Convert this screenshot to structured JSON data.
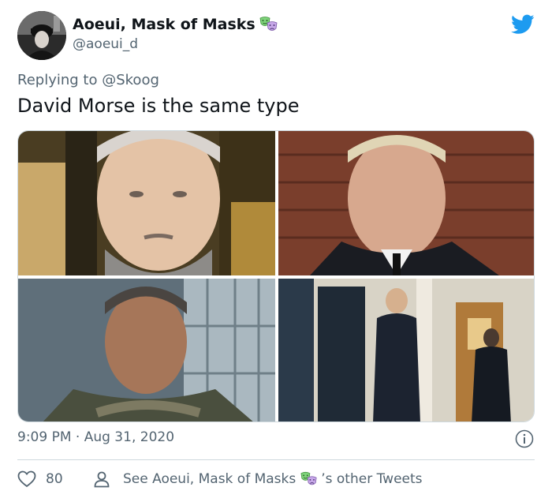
{
  "tweet": {
    "display_name": "Aoeui, Mask of Masks",
    "name_emoji": "performing-arts-masks",
    "handle": "@aoeui_d",
    "replying_prefix": "Replying to",
    "replying_handle": "@Skoog",
    "text": "David Morse is the same type",
    "timestamp": "9:09 PM · Aug 31, 2020",
    "likes": "80",
    "see_other_prefix": "See Aoeui, Mask of Masks",
    "see_other_suffix": "’s other Tweets"
  },
  "icons": {
    "brand": "twitter-bird-icon",
    "info": "info-icon",
    "like": "heart-icon",
    "profile": "person-icon"
  },
  "colors": {
    "brand_blue": "#1d9bf0",
    "text_primary": "#0f1419",
    "text_secondary": "#536471",
    "border": "#cfd9de"
  },
  "media": {
    "count": 4
  }
}
